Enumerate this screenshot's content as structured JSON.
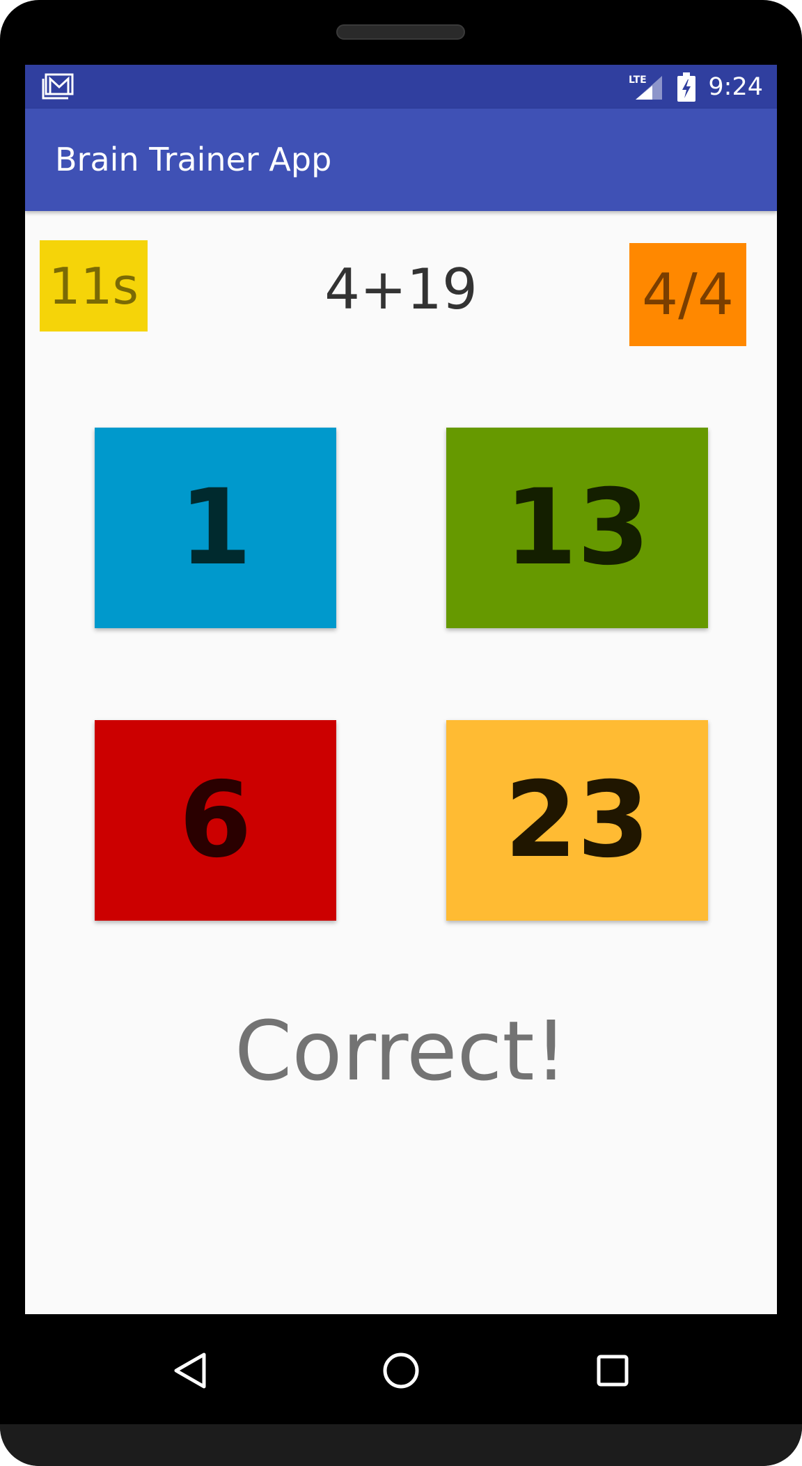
{
  "status_bar": {
    "notification_icon": "gmail-icon",
    "network_label": "LTE",
    "time": "9:24"
  },
  "app_bar": {
    "title": "Brain Trainer App"
  },
  "game": {
    "timer": "11s",
    "question": "4+19",
    "score": "4/4",
    "answers": [
      "1",
      "13",
      "6",
      "23"
    ],
    "result": "Correct!"
  },
  "colors": {
    "status_bar": "#303f9f",
    "app_bar": "#3f51b5",
    "timer_bg": "#f5d409",
    "score_bg": "#ff8800",
    "answer_blue": "#0099cc",
    "answer_green": "#669900",
    "answer_red": "#cc0000",
    "answer_amber": "#ffbb33"
  },
  "nav_bar": {
    "back_icon": "back-triangle-icon",
    "home_icon": "home-circle-icon",
    "recents_icon": "recents-square-icon"
  }
}
